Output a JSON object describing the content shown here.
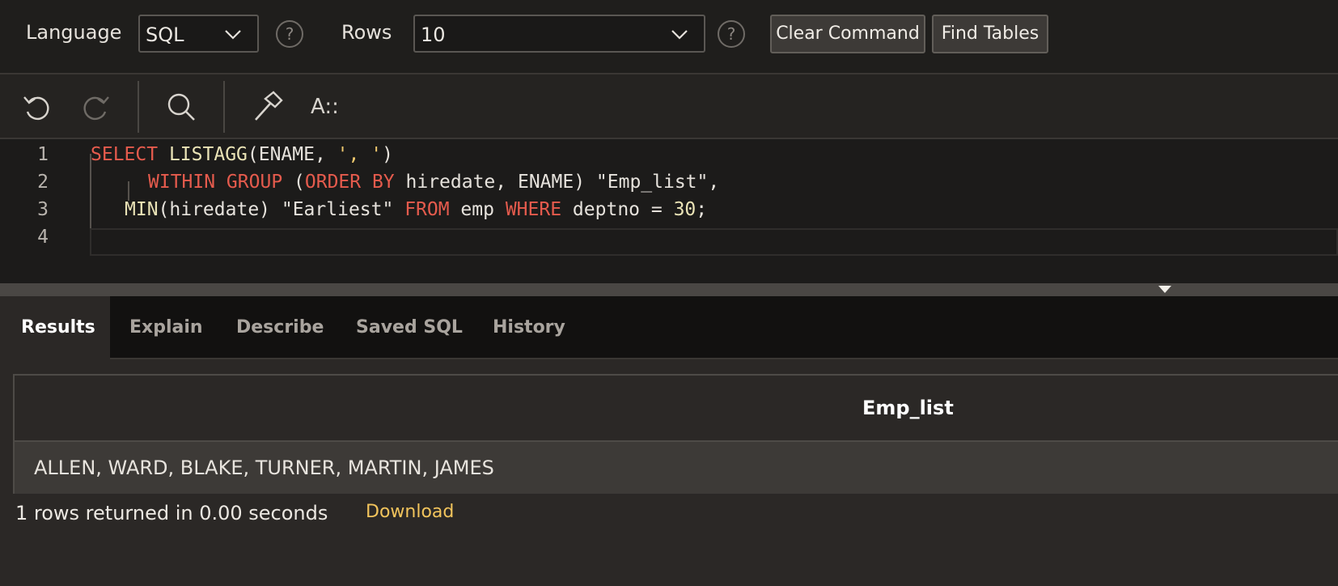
{
  "settings": {
    "language_label": "Language",
    "language_value": "SQL",
    "rows_label": "Rows",
    "rows_value": "10",
    "help_glyph": "?",
    "clear_command": "Clear Command",
    "find_tables": "Find Tables"
  },
  "toolbar": {
    "icons": [
      "undo-icon",
      "redo-icon",
      "search-icon",
      "hammer-icon",
      "format-icon"
    ],
    "format_glyph": "A::"
  },
  "editor": {
    "line_numbers": [
      "1",
      "2",
      "3",
      "4"
    ],
    "lines": [
      [
        {
          "t": "SELECT",
          "c": "kw"
        },
        {
          "t": " ",
          "c": ""
        },
        {
          "t": "LISTAGG",
          "c": "fn"
        },
        {
          "t": "(ENAME, ",
          "c": ""
        },
        {
          "t": "', '",
          "c": "str"
        },
        {
          "t": ")",
          "c": ""
        }
      ],
      [
        {
          "t": "WITHIN GROUP",
          "c": "kw"
        },
        {
          "t": " (",
          "c": ""
        },
        {
          "t": "ORDER BY",
          "c": "kw"
        },
        {
          "t": " hiredate, ENAME) \"Emp_list\",",
          "c": ""
        }
      ],
      [
        {
          "t": "MIN",
          "c": "fn"
        },
        {
          "t": "(hiredate) \"Earliest\" ",
          "c": ""
        },
        {
          "t": "FROM",
          "c": "kw"
        },
        {
          "t": " emp ",
          "c": ""
        },
        {
          "t": "WHERE",
          "c": "kw"
        },
        {
          "t": " deptno = ",
          "c": ""
        },
        {
          "t": "30",
          "c": "num"
        },
        {
          "t": ";",
          "c": ""
        }
      ],
      []
    ]
  },
  "tabs": [
    {
      "label": "Results",
      "active": true
    },
    {
      "label": "Explain",
      "active": false
    },
    {
      "label": "Describe",
      "active": false
    },
    {
      "label": "Saved SQL",
      "active": false
    },
    {
      "label": "History",
      "active": false
    }
  ],
  "results": {
    "columns": [
      "Emp_list"
    ],
    "rows": [
      [
        "ALLEN, WARD, BLAKE, TURNER, MARTIN, JAMES"
      ]
    ],
    "status": "1 rows returned in 0.00 seconds",
    "download_label": "Download"
  },
  "colors": {
    "keyword": "#e55b4d",
    "function": "#eae3b6",
    "string": "#f0c96e",
    "download_link": "#f2c45c"
  }
}
